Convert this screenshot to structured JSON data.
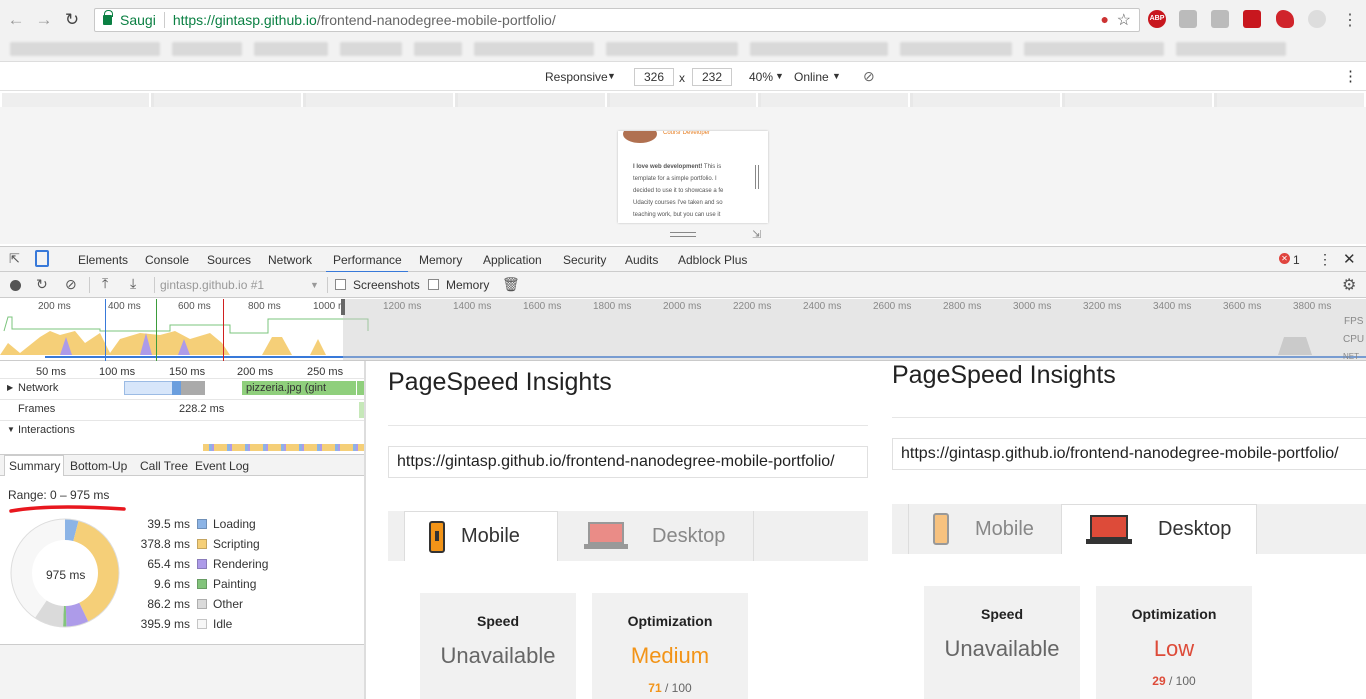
{
  "browser": {
    "secure_label": "Saugi",
    "url_host": "https://gintasp.github.io",
    "url_path": "/frontend-nanodegree-mobile-portfolio/"
  },
  "device_toolbar": {
    "mode": "Responsive",
    "width": "326",
    "times": "x",
    "height": "232",
    "zoom": "40%",
    "network": "Online"
  },
  "preview": {
    "subtitle": "Coursr Developer",
    "bold": "I love web development!",
    "lines": [
      " This is",
      "template for a simple portfolio. I",
      "decided to use it to showcase a fe",
      "Udacity courses I've taken and so",
      "teaching work, but you can use it"
    ]
  },
  "devtools": {
    "tabs": [
      "Elements",
      "Console",
      "Sources",
      "Network",
      "Performance",
      "Memory",
      "Application",
      "Security",
      "Audits",
      "Adblock Plus"
    ],
    "error_count": "1",
    "recording": "gintasp.github.io #1",
    "screenshots_label": "Screenshots",
    "memory_label": "Memory",
    "overview_ticks": [
      "200 ms",
      "400 ms",
      "600 ms",
      "800 ms",
      "1000 r",
      "1200 ms",
      "1400 ms",
      "1600 ms",
      "1800 ms",
      "2000 ms",
      "2200 ms",
      "2400 ms",
      "2600 ms",
      "2800 ms",
      "3000 ms",
      "3200 ms",
      "3400 ms",
      "3600 ms",
      "3800 ms"
    ],
    "fps_label": "FPS",
    "cpu_label": "CPU",
    "net_label": "NET",
    "flame_ticks": [
      "50 ms",
      "100 ms",
      "150 ms",
      "200 ms",
      "250 ms"
    ],
    "network_row": "Network",
    "net_item": "pizzeria.jpg (gint",
    "frames_row": "Frames",
    "frame_time": "228.2 ms",
    "interactions_row": "Interactions",
    "bottom_tabs": [
      "Summary",
      "Bottom-Up",
      "Call Tree",
      "Event Log"
    ],
    "range": "Range: 0 – 975 ms",
    "total": "975 ms",
    "summary": [
      {
        "value": "39.5 ms",
        "label": "Loading",
        "ms": 39.5,
        "color": "#8cb4e6"
      },
      {
        "value": "378.8 ms",
        "label": "Scripting",
        "ms": 378.8,
        "color": "#f5cf78"
      },
      {
        "value": "65.4 ms",
        "label": "Rendering",
        "ms": 65.4,
        "color": "#ad9be9"
      },
      {
        "value": "9.6 ms",
        "label": "Painting",
        "ms": 9.6,
        "color": "#83c47c"
      },
      {
        "value": "86.2 ms",
        "label": "Other",
        "ms": 86.2,
        "color": "#dadada"
      },
      {
        "value": "395.9 ms",
        "label": "Idle",
        "ms": 395.9,
        "color": "#f7f7f7"
      }
    ]
  },
  "pagespeed_left": {
    "title": "PageSpeed Insights",
    "url": "https://gintasp.github.io/frontend-nanodegree-mobile-portfolio/",
    "tab_mobile": "Mobile",
    "tab_desktop": "Desktop",
    "speed_title": "Speed",
    "speed_value": "Unavailable",
    "opt_title": "Optimization",
    "opt_value": "Medium",
    "opt_score": "71",
    "opt_max": " / 100",
    "opt_color": "#f29418"
  },
  "pagespeed_right": {
    "title": "PageSpeed Insights",
    "url": "https://gintasp.github.io/frontend-nanodegree-mobile-portfolio/",
    "tab_mobile": "Mobile",
    "tab_desktop": "Desktop",
    "speed_title": "Speed",
    "speed_value": "Unavailable",
    "opt_title": "Optimization",
    "opt_value": "Low",
    "opt_score": "29",
    "opt_max": " / 100",
    "opt_color": "#dd4b39"
  }
}
